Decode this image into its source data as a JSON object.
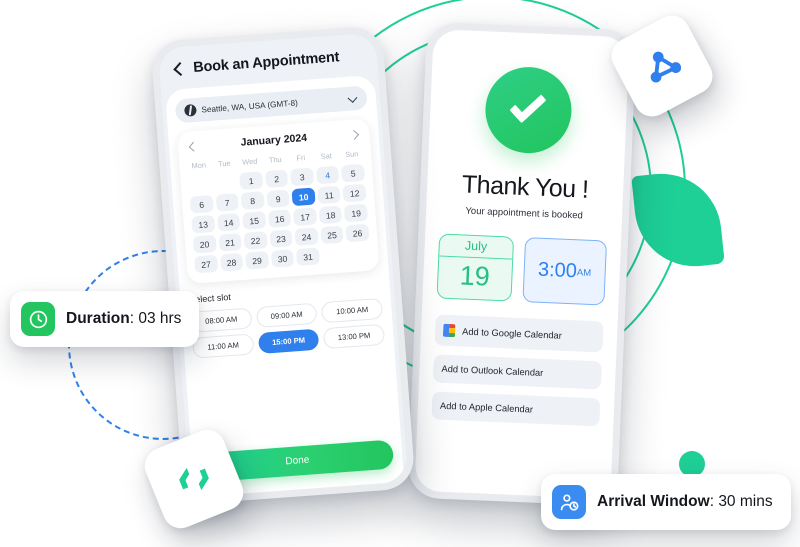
{
  "decorations": {
    "green_ring_color": "#1ecf96",
    "blue_dashed_ring_color": "#2f80ed",
    "green_sector_color": "#1ecf96",
    "green_dot_color": "#1ecf96"
  },
  "badges": {
    "share": {
      "icon": "share-nodes-icon",
      "color": "#2f80ed"
    },
    "code": {
      "icon": "code-brackets-icon",
      "color": "#1ecf96"
    }
  },
  "pills": [
    {
      "id": "duration",
      "icon": "clock-icon",
      "icon_bg": "#22c55e",
      "label": "Duration",
      "separator": ": ",
      "value": "03 hrs"
    },
    {
      "id": "arrival",
      "icon": "person-clock-icon",
      "icon_bg": "#3b8cf0",
      "label": "Arrival Window",
      "separator": ": ",
      "value": "30 mins"
    }
  ],
  "booking_screen": {
    "back_icon": "chevron-left-icon",
    "title": "Book an Appointment",
    "timezone": {
      "icon": "globe-icon",
      "value": "Seattle, WA, USA (GMT-8)",
      "chevron": "chevron-down-icon"
    },
    "calendar": {
      "prev_icon": "chevron-left-icon",
      "month": "January 2024",
      "next_icon": "chevron-right-icon",
      "day_names": [
        "Mon",
        "Tue",
        "Wed",
        "Thu",
        "Fri",
        "Sat",
        "Sun"
      ],
      "leading_blanks": 2,
      "days": [
        {
          "n": "1"
        },
        {
          "n": "2"
        },
        {
          "n": "3"
        },
        {
          "n": "4",
          "style": "accent"
        },
        {
          "n": "5"
        },
        {
          "n": "6"
        },
        {
          "n": "7"
        },
        {
          "n": "8"
        },
        {
          "n": "9"
        },
        {
          "n": "10",
          "style": "selected"
        },
        {
          "n": "11"
        },
        {
          "n": "12"
        },
        {
          "n": "13"
        },
        {
          "n": "14"
        },
        {
          "n": "15"
        },
        {
          "n": "16"
        },
        {
          "n": "17"
        },
        {
          "n": "18"
        },
        {
          "n": "19"
        },
        {
          "n": "20"
        },
        {
          "n": "21"
        },
        {
          "n": "22"
        },
        {
          "n": "23"
        },
        {
          "n": "24"
        },
        {
          "n": "25"
        },
        {
          "n": "26"
        },
        {
          "n": "27"
        },
        {
          "n": "28"
        },
        {
          "n": "29"
        },
        {
          "n": "30"
        },
        {
          "n": "31"
        }
      ],
      "selected_day": "10"
    },
    "slots": {
      "title": "Select slot",
      "items": [
        {
          "label": "08:00 AM"
        },
        {
          "label": "09:00 AM"
        },
        {
          "label": "10:00 AM"
        },
        {
          "label": "11:00 AM"
        },
        {
          "label": "15:00 PM",
          "selected": true
        },
        {
          "label": "13:00 PM"
        }
      ],
      "selected": "15:00 PM"
    },
    "done_button": "Done"
  },
  "confirmation_screen": {
    "check_icon": "check-circle-icon",
    "heading": "Thank You !",
    "subheading": "Your appointment is booked",
    "date_card": {
      "month": "July",
      "day": "19",
      "color": "#25c083"
    },
    "time_card": {
      "time": "3:00",
      "meridiem": "AM",
      "color": "#2f80ed"
    },
    "calendar_buttons": [
      {
        "icon": "google-calendar-icon",
        "label": "Add to Google Calendar"
      },
      {
        "icon": "",
        "label": "Add to Outlook Calendar"
      },
      {
        "icon": "",
        "label": "Add to Apple Calendar"
      }
    ]
  }
}
